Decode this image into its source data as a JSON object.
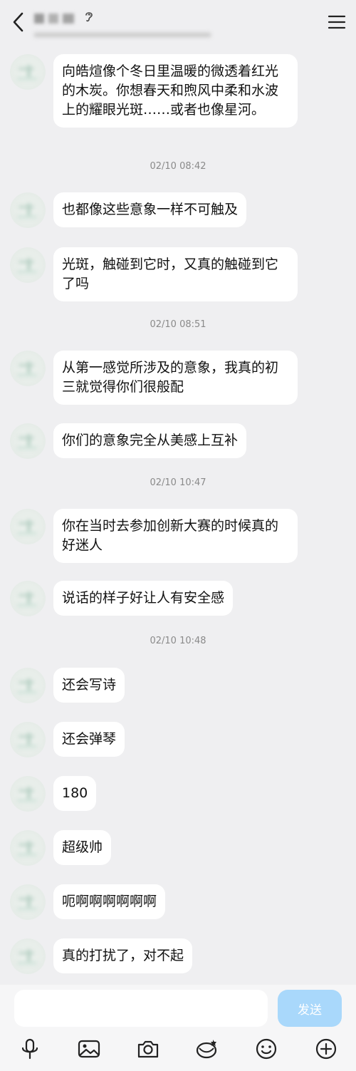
{
  "header": {
    "title": "",
    "subtitle": ""
  },
  "messages": [
    {
      "type": "msg",
      "text": "向皓煊像个冬日里温暖的微透着红光的木炭。你想春天和煦风中柔和水波上的耀眼光斑……或者也像星河。"
    },
    {
      "type": "time",
      "text": "02/10 08:42"
    },
    {
      "type": "msg",
      "text": "也都像这些意象一样不可触及"
    },
    {
      "type": "msg",
      "text": "光斑，触碰到它时，又真的触碰到它了吗"
    },
    {
      "type": "time",
      "text": "02/10 08:51"
    },
    {
      "type": "msg",
      "text": "从第一感觉所涉及的意象，我真的初三就觉得你们很般配"
    },
    {
      "type": "msg",
      "text": "你们的意象完全从美感上互补"
    },
    {
      "type": "time",
      "text": "02/10 10:47"
    },
    {
      "type": "msg",
      "text": "你在当时去参加创新大赛的时候真的好迷人"
    },
    {
      "type": "msg",
      "text": "说话的样子好让人有安全感"
    },
    {
      "type": "time",
      "text": "02/10 10:48"
    },
    {
      "type": "msg",
      "text": "还会写诗"
    },
    {
      "type": "msg",
      "text": "还会弹琴"
    },
    {
      "type": "msg",
      "text": "180"
    },
    {
      "type": "msg",
      "text": "超级帅"
    },
    {
      "type": "msg",
      "text": "呃啊啊啊啊啊啊"
    },
    {
      "type": "msg",
      "text": "真的打扰了，对不起"
    }
  ],
  "input": {
    "value": "",
    "placeholder": "",
    "send_label": "发送"
  },
  "toolbar": {
    "items": [
      "microphone-icon",
      "image-icon",
      "camera-icon",
      "red-packet-icon",
      "emoji-icon",
      "plus-icon"
    ]
  },
  "colors": {
    "background": "#efeff1",
    "bubble": "#ffffff",
    "send_button": "#a9d8fb",
    "timestamp": "#8a8a8a"
  }
}
